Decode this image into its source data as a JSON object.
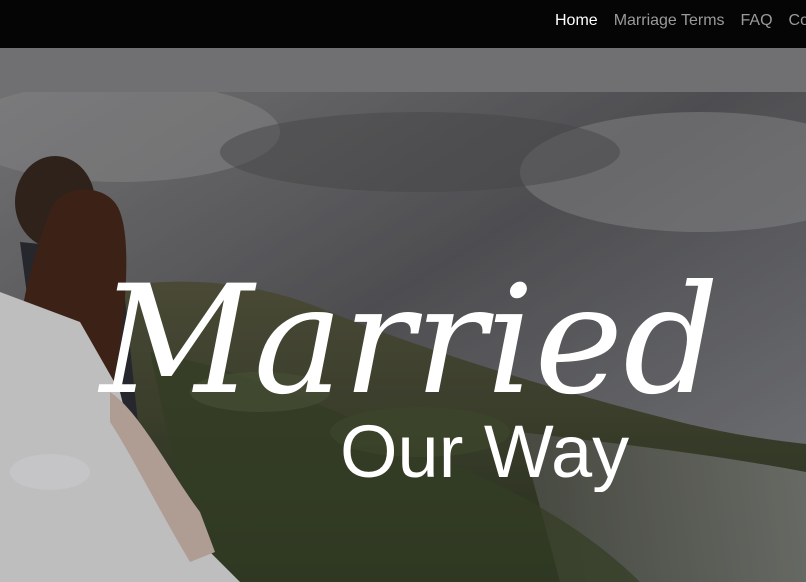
{
  "nav": {
    "items": [
      {
        "label": "Home",
        "active": true
      },
      {
        "label": "Marriage Terms",
        "active": false
      },
      {
        "label": "FAQ",
        "active": false
      },
      {
        "label": "Co",
        "active": false
      }
    ]
  },
  "hero": {
    "logo": {
      "script_text": "Married",
      "sub_text": "Our Way"
    },
    "image_alt": "bride and groom on mountain slope under cloudy sky"
  },
  "colors": {
    "navbar_bg": "#050505",
    "nav_active": "#ffffff",
    "nav_inactive": "#9a9a9a",
    "band_bg": "#707072",
    "logo": "#ffffff"
  }
}
